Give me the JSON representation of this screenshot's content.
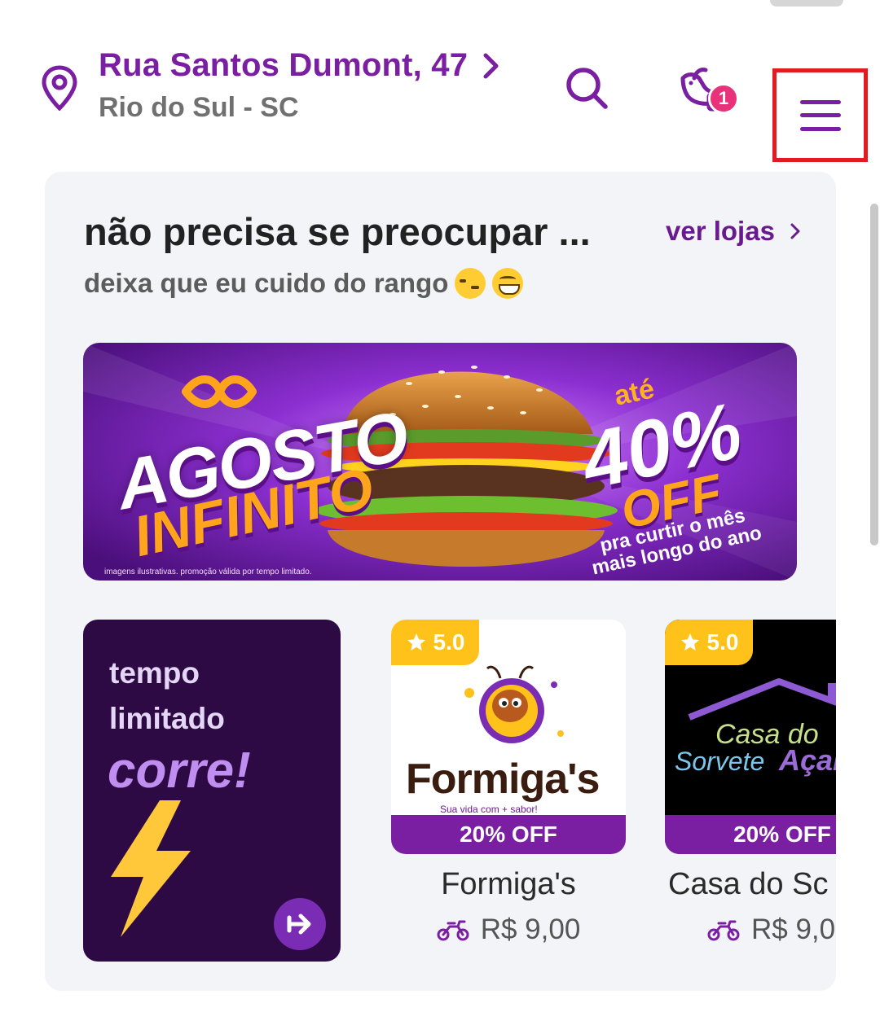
{
  "header": {
    "address_street": "Rua Santos Dumont, 47",
    "address_city": "Rio do Sul - SC",
    "notification_count": "1",
    "icons": {
      "location": "location-pin-icon",
      "address_chevron": "chevron-right-icon",
      "search": "search-icon",
      "notifications": "bird-mail-icon",
      "menu": "hamburger-menu-icon"
    }
  },
  "section": {
    "title": "não precisa se preocupar ...",
    "see_all_label": "ver lojas",
    "subtitle": "deixa que eu cuido do rango"
  },
  "banner": {
    "headline_1": "AGOSTO",
    "headline_2": "INFINITO",
    "upto": "até",
    "discount": "40%",
    "off": "OFF",
    "tagline_1": "pra curtir o mês",
    "tagline_2": "mais longo do ano",
    "disclaimer": "imagens ilustrativas. promoção válida por tempo limitado."
  },
  "promo_tile": {
    "line_1": "tempo",
    "line_2": "limitado",
    "line_3": "corre!"
  },
  "stores": [
    {
      "name": "Formiga's",
      "rating": "5.0",
      "discount": "20% OFF",
      "delivery_fee": "R$ 9,00",
      "logo_word": "Formiga's",
      "logo_slogan": "Sua vida com + sabor!"
    },
    {
      "name": "Casa do Sc",
      "rating": "5.0",
      "discount": "20% OFF",
      "delivery_fee": "R$ 9,0",
      "logo_word_1": "Casa do",
      "logo_word_2": "Sorvete",
      "logo_word_3": "Açaí"
    }
  ],
  "colors": {
    "brand_purple": "#7a1fa2",
    "highlight_red": "#e21a22",
    "rating_yellow": "#ffc21a",
    "badge_pink": "#e8327a"
  }
}
